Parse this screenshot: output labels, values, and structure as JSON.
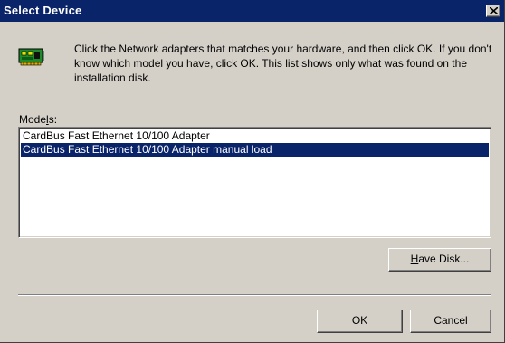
{
  "window": {
    "title": "Select Device"
  },
  "instructions": "Click the Network adapters that matches your hardware, and then click OK. If you don't know which model you have, click OK. This list shows only what was found on the installation disk.",
  "models": {
    "label_pre": "Mode",
    "label_hotkey": "l",
    "label_post": "s:",
    "items": [
      {
        "label": "CardBus Fast Ethernet 10/100 Adapter",
        "selected": false
      },
      {
        "label": "CardBus Fast Ethernet 10/100 Adapter manual load",
        "selected": true
      }
    ]
  },
  "buttons": {
    "have_disk_hotkey": "H",
    "have_disk_rest": "ave Disk...",
    "ok": "OK",
    "cancel": "Cancel"
  },
  "icons": {
    "adapter": "network-adapter-icon",
    "close": "close-icon"
  },
  "colors": {
    "titlebar": "#0a246a",
    "selection": "#0a246a",
    "face": "#d4d0c8"
  }
}
